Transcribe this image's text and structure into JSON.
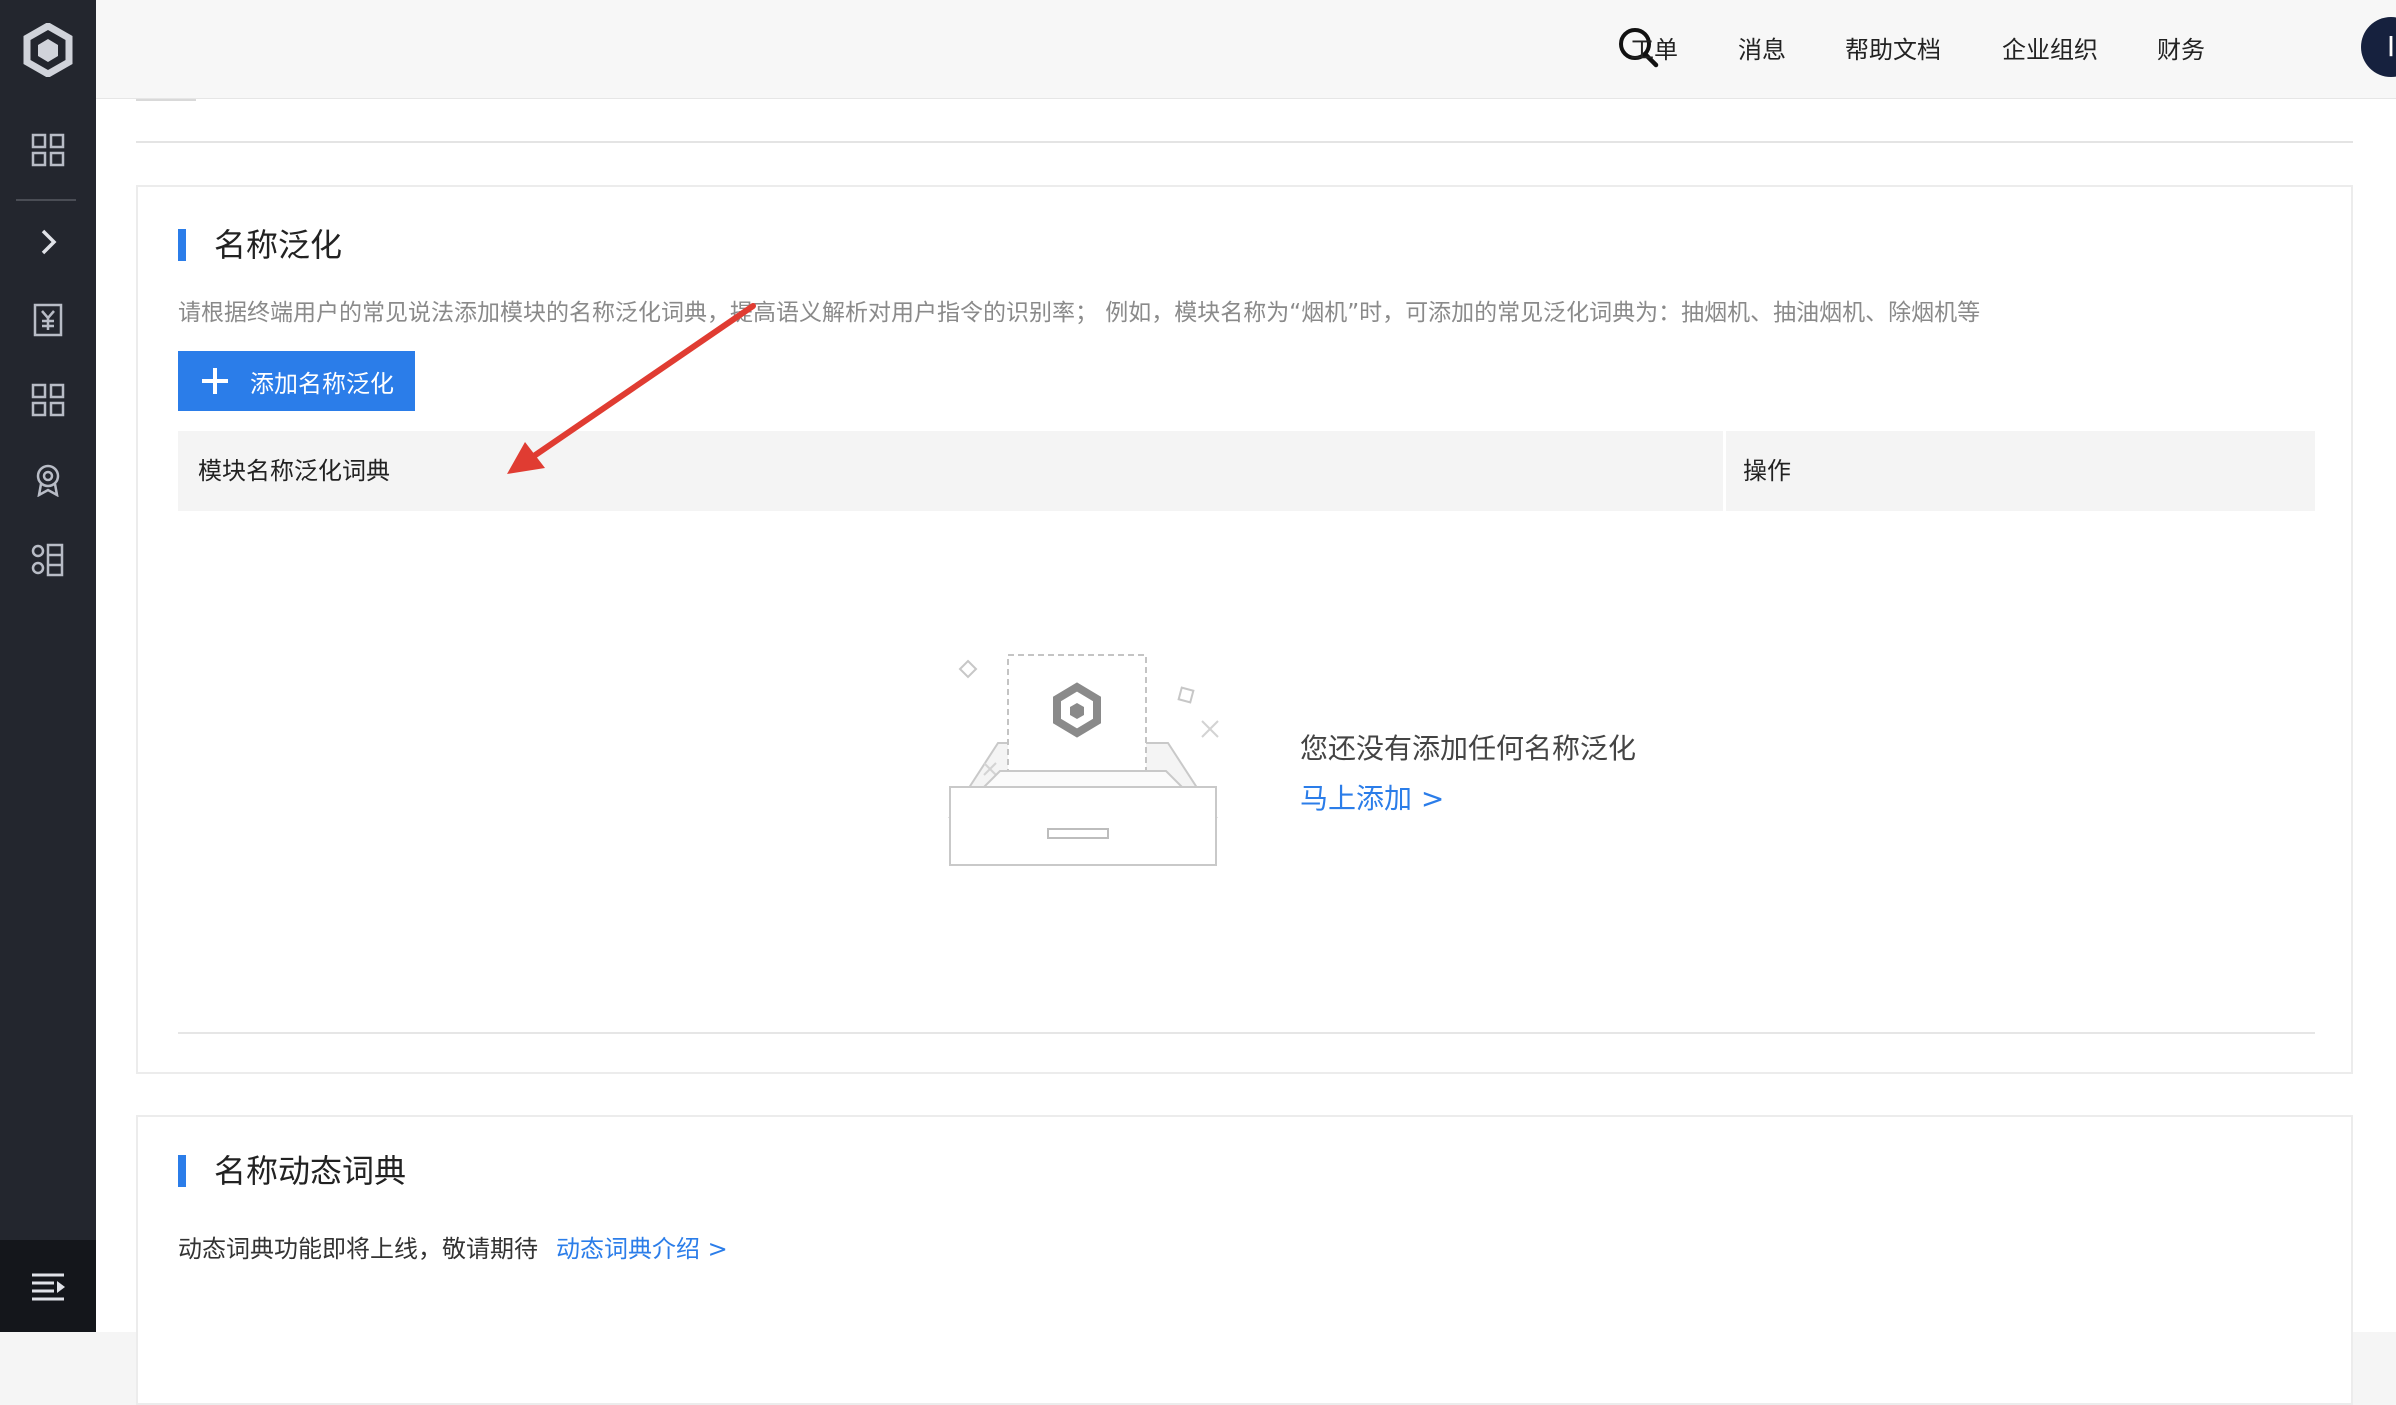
{
  "sidebar": {
    "logo_icon": "cube-logo-icon",
    "items": [
      {
        "icon": "grid-icon"
      },
      {
        "icon": "chevron-right-icon"
      },
      {
        "icon": "yuan-bill-icon"
      },
      {
        "icon": "grid-icon"
      },
      {
        "icon": "badge-icon"
      },
      {
        "icon": "modules-icon"
      }
    ],
    "bottom_icon": "menu-collapse-icon"
  },
  "header": {
    "search_icon": "search-icon",
    "links": [
      "工单",
      "消息",
      "帮助文档",
      "企业组织",
      "财务"
    ],
    "avatar_initial": "I",
    "caret_icon": "chevron-down-icon"
  },
  "generalization": {
    "title": "名称泛化",
    "description": "请根据终端用户的常见说法添加模块的名称泛化词典，提高语义解析对用户指令的识别率； 例如，模块名称为“烟机”时，可添加的常见泛化词典为：抽烟机、抽油烟机、除烟机等",
    "add_button_label": "添加名称泛化",
    "table": {
      "columns": [
        "模块名称泛化词典",
        "操作"
      ]
    },
    "empty": {
      "message": "您还没有添加任何名称泛化",
      "link": "马上添加 >"
    }
  },
  "dynamic_dict": {
    "title": "名称动态词典",
    "text": "动态词典功能即将上线，敬请期待",
    "link": "动态词典介绍 >"
  },
  "colors": {
    "accent": "#2b7de9",
    "sidebar_bg": "#23262e",
    "annotation_arrow": "#e03c32"
  }
}
